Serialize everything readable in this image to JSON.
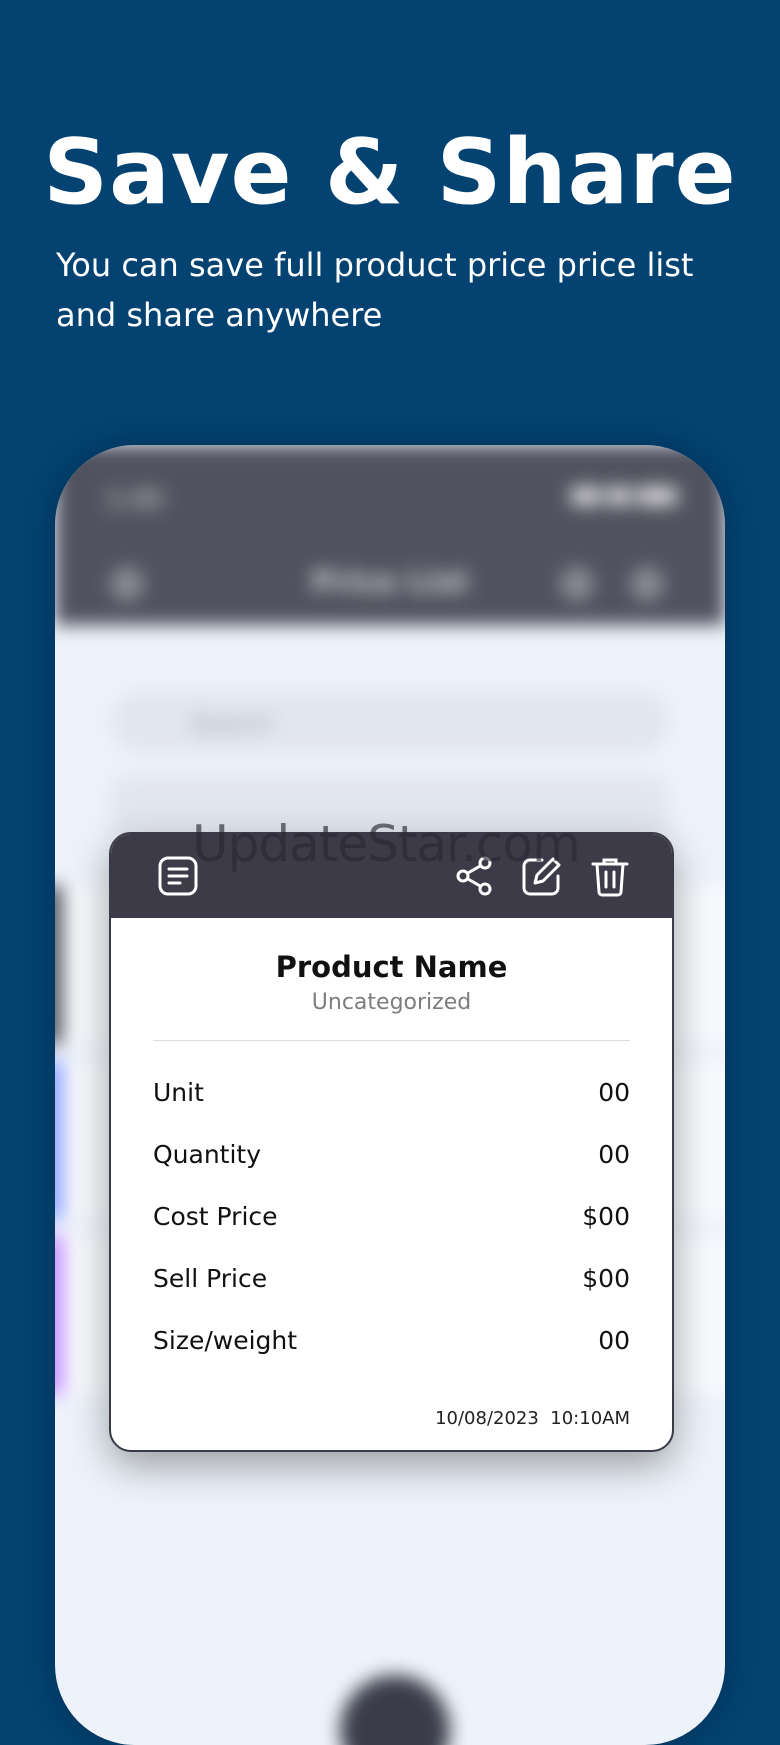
{
  "hero": {
    "title": "Save & Share",
    "subtitle_line1": "You can save full product price price list",
    "subtitle_line2": "and share anywhere"
  },
  "watermark": "UpdateStar.com",
  "colors": {
    "background": "#034271",
    "card_toolbar": "#3d3b48",
    "phone_topbar": "#50525f"
  },
  "card": {
    "icons": [
      "document-icon",
      "share-icon",
      "edit-icon",
      "trash-icon"
    ],
    "product_name": "Product Name",
    "category": "Uncategorized",
    "rows": [
      {
        "label": "Unit",
        "value": "00"
      },
      {
        "label": "Quantity",
        "value": "00"
      },
      {
        "label": "Cost Price",
        "value": "$00"
      },
      {
        "label": "Sell Price",
        "value": "$00"
      },
      {
        "label": "Size/weight",
        "value": "00"
      }
    ],
    "date": "10/08/2023",
    "time": "10:10AM"
  }
}
